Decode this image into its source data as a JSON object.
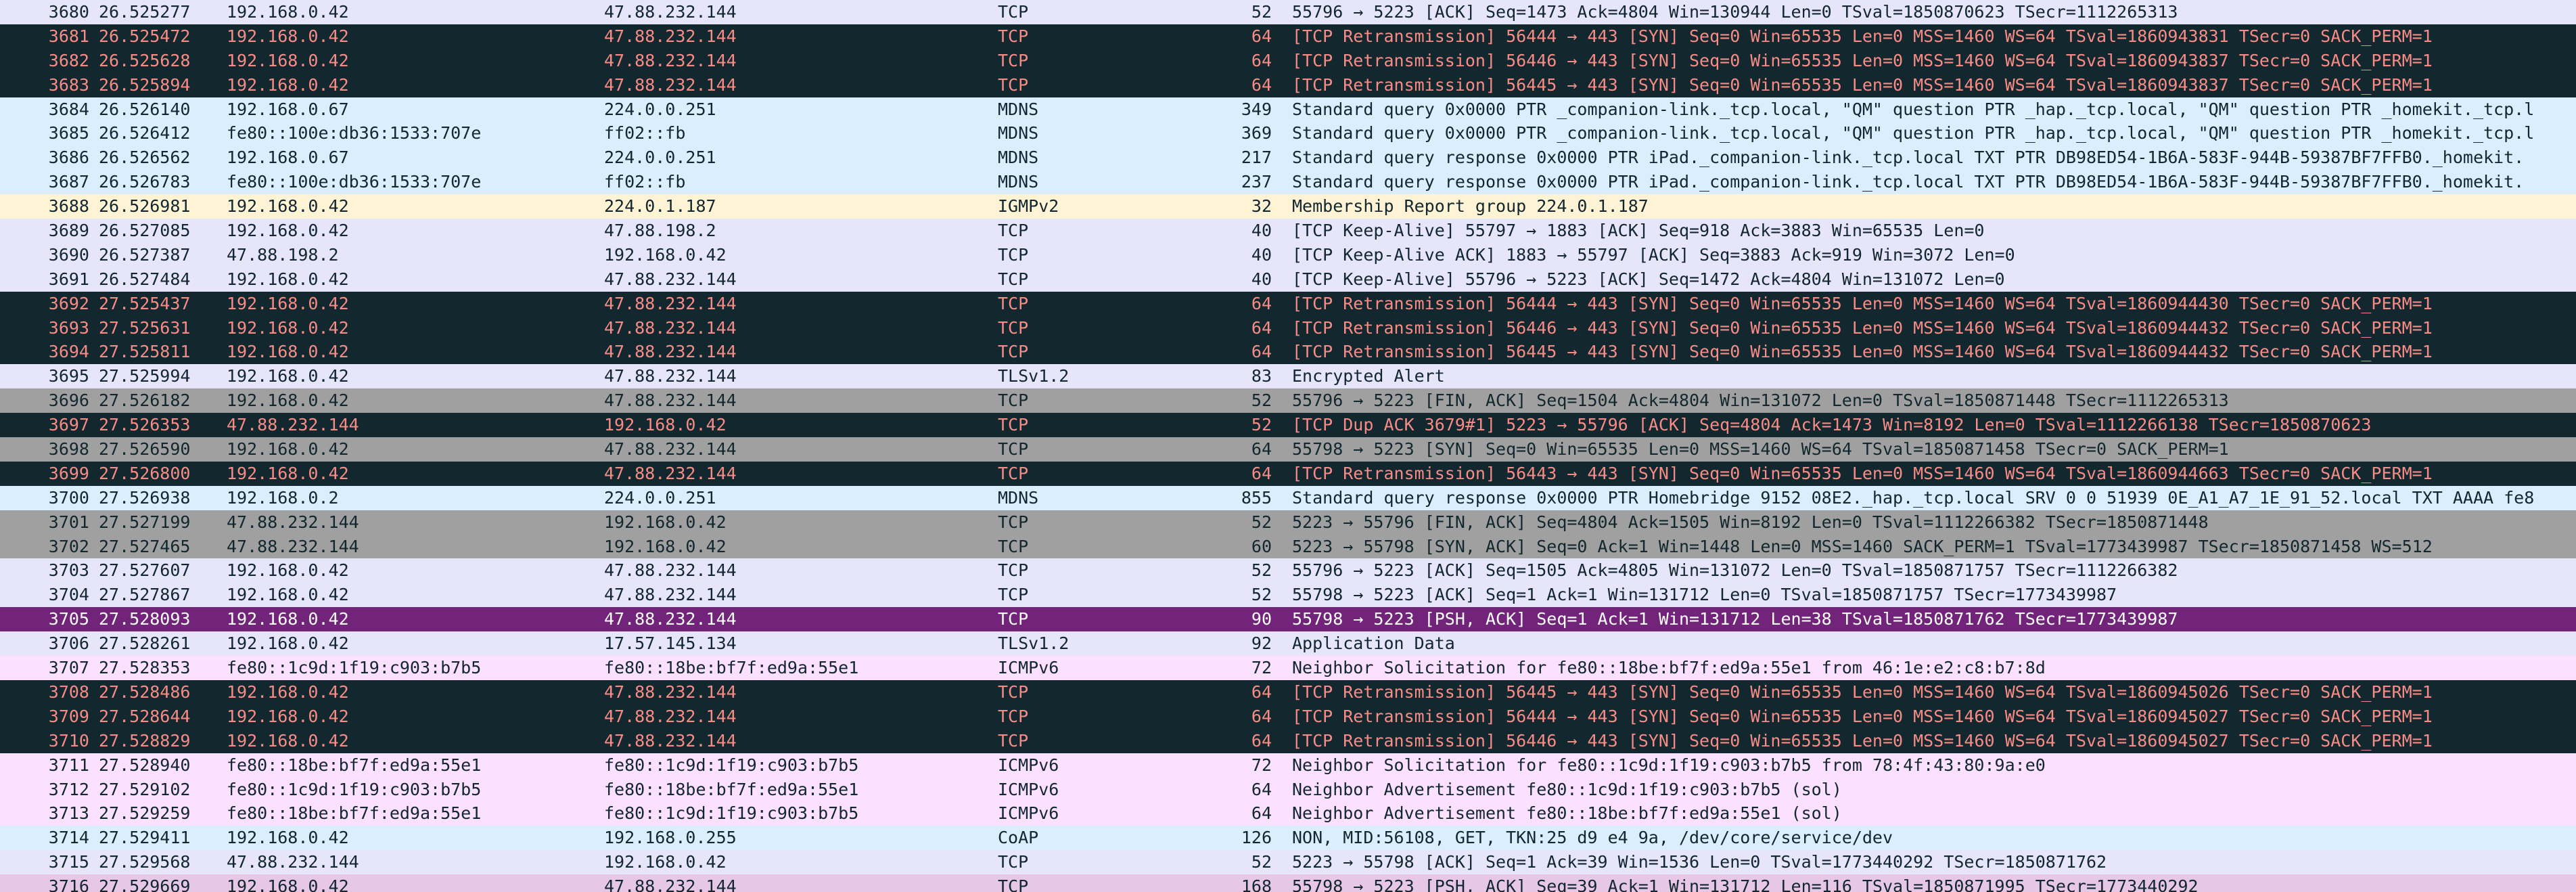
{
  "packets": [
    {
      "no": "3680",
      "time": "26.525277",
      "src": "192.168.0.42",
      "dst": "47.88.232.144",
      "proto": "TCP",
      "len": "52",
      "info": "55796 → 5223 [ACK] Seq=1473 Ack=4804 Win=130944 Len=0 TSval=1850870623 TSecr=1112265313",
      "style": "tcp"
    },
    {
      "no": "3681",
      "time": "26.525472",
      "src": "192.168.0.42",
      "dst": "47.88.232.144",
      "proto": "TCP",
      "len": "64",
      "info": "[TCP Retransmission] 56444 → 443 [SYN] Seq=0 Win=65535 Len=0 MSS=1460 WS=64 TSval=1860943831 TSecr=0 SACK_PERM=1",
      "style": "retx"
    },
    {
      "no": "3682",
      "time": "26.525628",
      "src": "192.168.0.42",
      "dst": "47.88.232.144",
      "proto": "TCP",
      "len": "64",
      "info": "[TCP Retransmission] 56446 → 443 [SYN] Seq=0 Win=65535 Len=0 MSS=1460 WS=64 TSval=1860943837 TSecr=0 SACK_PERM=1",
      "style": "retx"
    },
    {
      "no": "3683",
      "time": "26.525894",
      "src": "192.168.0.42",
      "dst": "47.88.232.144",
      "proto": "TCP",
      "len": "64",
      "info": "[TCP Retransmission] 56445 → 443 [SYN] Seq=0 Win=65535 Len=0 MSS=1460 WS=64 TSval=1860943837 TSecr=0 SACK_PERM=1",
      "style": "retx"
    },
    {
      "no": "3684",
      "time": "26.526140",
      "src": "192.168.0.67",
      "dst": "224.0.0.251",
      "proto": "MDNS",
      "len": "349",
      "info": "Standard query 0x0000 PTR _companion-link._tcp.local, \"QM\" question PTR _hap._tcp.local, \"QM\" question PTR _homekit._tcp.l",
      "style": "mdns"
    },
    {
      "no": "3685",
      "time": "26.526412",
      "src": "fe80::100e:db36:1533:707e",
      "dst": "ff02::fb",
      "proto": "MDNS",
      "len": "369",
      "info": "Standard query 0x0000 PTR _companion-link._tcp.local, \"QM\" question PTR _hap._tcp.local, \"QM\" question PTR _homekit._tcp.l",
      "style": "mdns"
    },
    {
      "no": "3686",
      "time": "26.526562",
      "src": "192.168.0.67",
      "dst": "224.0.0.251",
      "proto": "MDNS",
      "len": "217",
      "info": "Standard query response 0x0000 PTR iPad._companion-link._tcp.local TXT PTR DB98ED54-1B6A-583F-944B-59387BF7FFB0._homekit.",
      "style": "mdns"
    },
    {
      "no": "3687",
      "time": "26.526783",
      "src": "fe80::100e:db36:1533:707e",
      "dst": "ff02::fb",
      "proto": "MDNS",
      "len": "237",
      "info": "Standard query response 0x0000 PTR iPad._companion-link._tcp.local TXT PTR DB98ED54-1B6A-583F-944B-59387BF7FFB0._homekit.",
      "style": "mdns"
    },
    {
      "no": "3688",
      "time": "26.526981",
      "src": "192.168.0.42",
      "dst": "224.0.1.187",
      "proto": "IGMPv2",
      "len": "32",
      "info": "Membership Report group 224.0.1.187",
      "style": "igmp"
    },
    {
      "no": "3689",
      "time": "26.527085",
      "src": "192.168.0.42",
      "dst": "47.88.198.2",
      "proto": "TCP",
      "len": "40",
      "info": "[TCP Keep-Alive] 55797 → 1883 [ACK] Seq=918 Ack=3883 Win=65535 Len=0",
      "style": "tcp"
    },
    {
      "no": "3690",
      "time": "26.527387",
      "src": "47.88.198.2",
      "dst": "192.168.0.42",
      "proto": "TCP",
      "len": "40",
      "info": "[TCP Keep-Alive ACK] 1883 → 55797 [ACK] Seq=3883 Ack=919 Win=3072 Len=0",
      "style": "tcp"
    },
    {
      "no": "3691",
      "time": "26.527484",
      "src": "192.168.0.42",
      "dst": "47.88.232.144",
      "proto": "TCP",
      "len": "40",
      "info": "[TCP Keep-Alive] 55796 → 5223 [ACK] Seq=1472 Ack=4804 Win=131072 Len=0",
      "style": "tcp"
    },
    {
      "no": "3692",
      "time": "27.525437",
      "src": "192.168.0.42",
      "dst": "47.88.232.144",
      "proto": "TCP",
      "len": "64",
      "info": "[TCP Retransmission] 56444 → 443 [SYN] Seq=0 Win=65535 Len=0 MSS=1460 WS=64 TSval=1860944430 TSecr=0 SACK_PERM=1",
      "style": "retx"
    },
    {
      "no": "3693",
      "time": "27.525631",
      "src": "192.168.0.42",
      "dst": "47.88.232.144",
      "proto": "TCP",
      "len": "64",
      "info": "[TCP Retransmission] 56446 → 443 [SYN] Seq=0 Win=65535 Len=0 MSS=1460 WS=64 TSval=1860944432 TSecr=0 SACK_PERM=1",
      "style": "retx"
    },
    {
      "no": "3694",
      "time": "27.525811",
      "src": "192.168.0.42",
      "dst": "47.88.232.144",
      "proto": "TCP",
      "len": "64",
      "info": "[TCP Retransmission] 56445 → 443 [SYN] Seq=0 Win=65535 Len=0 MSS=1460 WS=64 TSval=1860944432 TSecr=0 SACK_PERM=1",
      "style": "retx"
    },
    {
      "no": "3695",
      "time": "27.525994",
      "src": "192.168.0.42",
      "dst": "47.88.232.144",
      "proto": "TLSv1.2",
      "len": "83",
      "info": "Encrypted Alert",
      "style": "tls"
    },
    {
      "no": "3696",
      "time": "27.526182",
      "src": "192.168.0.42",
      "dst": "47.88.232.144",
      "proto": "TCP",
      "len": "52",
      "info": "55796 → 5223 [FIN, ACK] Seq=1504 Ack=4804 Win=131072 Len=0 TSval=1850871448 TSecr=1112265313",
      "style": "fin"
    },
    {
      "no": "3697",
      "time": "27.526353",
      "src": "47.88.232.144",
      "dst": "192.168.0.42",
      "proto": "TCP",
      "len": "52",
      "info": "[TCP Dup ACK 3679#1] 5223 → 55796 [ACK] Seq=4804 Ack=1473 Win=8192 Len=0 TSval=1112266138 TSecr=1850870623",
      "style": "retx"
    },
    {
      "no": "3698",
      "time": "27.526590",
      "src": "192.168.0.42",
      "dst": "47.88.232.144",
      "proto": "TCP",
      "len": "64",
      "info": "55798 → 5223 [SYN] Seq=0 Win=65535 Len=0 MSS=1460 WS=64 TSval=1850871458 TSecr=0 SACK_PERM=1",
      "style": "fin"
    },
    {
      "no": "3699",
      "time": "27.526800",
      "src": "192.168.0.42",
      "dst": "47.88.232.144",
      "proto": "TCP",
      "len": "64",
      "info": "[TCP Retransmission] 56443 → 443 [SYN] Seq=0 Win=65535 Len=0 MSS=1460 WS=64 TSval=1860944663 TSecr=0 SACK_PERM=1",
      "style": "retx"
    },
    {
      "no": "3700",
      "time": "27.526938",
      "src": "192.168.0.2",
      "dst": "224.0.0.251",
      "proto": "MDNS",
      "len": "855",
      "info": "Standard query response 0x0000 PTR Homebridge 9152 08E2._hap._tcp.local SRV 0 0 51939 0E_A1_A7_1E_91_52.local TXT AAAA fe8",
      "style": "mdns"
    },
    {
      "no": "3701",
      "time": "27.527199",
      "src": "47.88.232.144",
      "dst": "192.168.0.42",
      "proto": "TCP",
      "len": "52",
      "info": "5223 → 55796 [FIN, ACK] Seq=4804 Ack=1505 Win=8192 Len=0 TSval=1112266382 TSecr=1850871448",
      "style": "fin"
    },
    {
      "no": "3702",
      "time": "27.527465",
      "src": "47.88.232.144",
      "dst": "192.168.0.42",
      "proto": "TCP",
      "len": "60",
      "info": "5223 → 55798 [SYN, ACK] Seq=0 Ack=1 Win=1448 Len=0 MSS=1460 SACK_PERM=1 TSval=1773439987 TSecr=1850871458 WS=512",
      "style": "fin"
    },
    {
      "no": "3703",
      "time": "27.527607",
      "src": "192.168.0.42",
      "dst": "47.88.232.144",
      "proto": "TCP",
      "len": "52",
      "info": "55796 → 5223 [ACK] Seq=1505 Ack=4805 Win=131072 Len=0 TSval=1850871757 TSecr=1112266382",
      "style": "tcp"
    },
    {
      "no": "3704",
      "time": "27.527867",
      "src": "192.168.0.42",
      "dst": "47.88.232.144",
      "proto": "TCP",
      "len": "52",
      "info": "55798 → 5223 [ACK] Seq=1 Ack=1 Win=131712 Len=0 TSval=1850871757 TSecr=1773439987",
      "style": "tcp"
    },
    {
      "no": "3705",
      "time": "27.528093",
      "src": "192.168.0.42",
      "dst": "47.88.232.144",
      "proto": "TCP",
      "len": "90",
      "info": "55798 → 5223 [PSH, ACK] Seq=1 Ack=1 Win=131712 Len=38 TSval=1850871762 TSecr=1773439987",
      "style": "sel"
    },
    {
      "no": "3706",
      "time": "27.528261",
      "src": "192.168.0.42",
      "dst": "17.57.145.134",
      "proto": "TLSv1.2",
      "len": "92",
      "info": "Application Data",
      "style": "tls"
    },
    {
      "no": "3707",
      "time": "27.528353",
      "src": "fe80::1c9d:1f19:c903:b7b5",
      "dst": "fe80::18be:bf7f:ed9a:55e1",
      "proto": "ICMPv6",
      "len": "72",
      "info": "Neighbor Solicitation for fe80::18be:bf7f:ed9a:55e1 from 46:1e:e2:c8:b7:8d",
      "style": "icmp6"
    },
    {
      "no": "3708",
      "time": "27.528486",
      "src": "192.168.0.42",
      "dst": "47.88.232.144",
      "proto": "TCP",
      "len": "64",
      "info": "[TCP Retransmission] 56445 → 443 [SYN] Seq=0 Win=65535 Len=0 MSS=1460 WS=64 TSval=1860945026 TSecr=0 SACK_PERM=1",
      "style": "retx"
    },
    {
      "no": "3709",
      "time": "27.528644",
      "src": "192.168.0.42",
      "dst": "47.88.232.144",
      "proto": "TCP",
      "len": "64",
      "info": "[TCP Retransmission] 56444 → 443 [SYN] Seq=0 Win=65535 Len=0 MSS=1460 WS=64 TSval=1860945027 TSecr=0 SACK_PERM=1",
      "style": "retx"
    },
    {
      "no": "3710",
      "time": "27.528829",
      "src": "192.168.0.42",
      "dst": "47.88.232.144",
      "proto": "TCP",
      "len": "64",
      "info": "[TCP Retransmission] 56446 → 443 [SYN] Seq=0 Win=65535 Len=0 MSS=1460 WS=64 TSval=1860945027 TSecr=0 SACK_PERM=1",
      "style": "retx"
    },
    {
      "no": "3711",
      "time": "27.528940",
      "src": "fe80::18be:bf7f:ed9a:55e1",
      "dst": "fe80::1c9d:1f19:c903:b7b5",
      "proto": "ICMPv6",
      "len": "72",
      "info": "Neighbor Solicitation for fe80::1c9d:1f19:c903:b7b5 from 78:4f:43:80:9a:e0",
      "style": "icmp6"
    },
    {
      "no": "3712",
      "time": "27.529102",
      "src": "fe80::1c9d:1f19:c903:b7b5",
      "dst": "fe80::18be:bf7f:ed9a:55e1",
      "proto": "ICMPv6",
      "len": "64",
      "info": "Neighbor Advertisement fe80::1c9d:1f19:c903:b7b5 (sol)",
      "style": "icmp6"
    },
    {
      "no": "3713",
      "time": "27.529259",
      "src": "fe80::18be:bf7f:ed9a:55e1",
      "dst": "fe80::1c9d:1f19:c903:b7b5",
      "proto": "ICMPv6",
      "len": "64",
      "info": "Neighbor Advertisement fe80::18be:bf7f:ed9a:55e1 (sol)",
      "style": "icmp6"
    },
    {
      "no": "3714",
      "time": "27.529411",
      "src": "192.168.0.42",
      "dst": "192.168.0.255",
      "proto": "CoAP",
      "len": "126",
      "info": "NON, MID:56108, GET, TKN:25 d9 e4 9a, /dev/core/service/dev",
      "style": "coap"
    },
    {
      "no": "3715",
      "time": "27.529568",
      "src": "47.88.232.144",
      "dst": "192.168.0.42",
      "proto": "TCP",
      "len": "52",
      "info": "5223 → 55798 [ACK] Seq=1 Ack=39 Win=1536 Len=0 TSval=1773440292 TSecr=1850871762",
      "style": "tcp"
    },
    {
      "no": "3716",
      "time": "27.529669",
      "src": "192.168.0.42",
      "dst": "47.88.232.144",
      "proto": "TCP",
      "len": "168",
      "info": "55798 → 5223 [PSH, ACK] Seq=39 Ack=1 Win=131712 Len=116 TSval=1850871995 TSecr=1773440292",
      "style": "psh"
    }
  ]
}
